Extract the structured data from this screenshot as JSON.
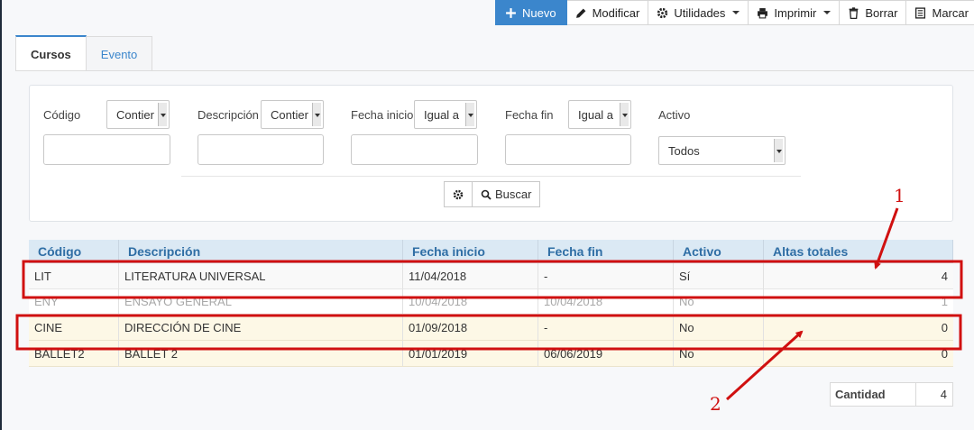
{
  "toolbar": {
    "nuevo": "Nuevo",
    "modificar": "Modificar",
    "utilidades": "Utilidades",
    "imprimir": "Imprimir",
    "borrar": "Borrar",
    "marcar": "Marcar"
  },
  "tabs": [
    {
      "label": "Cursos",
      "active": true
    },
    {
      "label": "Evento",
      "active": false
    }
  ],
  "filters": {
    "codigo": {
      "label": "Código",
      "operator": "Contier",
      "value": ""
    },
    "descripcion": {
      "label": "Descripción",
      "operator": "Contier",
      "value": ""
    },
    "fecha_inicio": {
      "label": "Fecha inicio",
      "operator": "Igual a",
      "value": ""
    },
    "fecha_fin": {
      "label": "Fecha fin",
      "operator": "Igual a",
      "value": ""
    },
    "activo": {
      "label": "Activo",
      "value": "Todos"
    },
    "buscar_label": "Buscar"
  },
  "table": {
    "headers": [
      "Código",
      "Descripción",
      "Fecha inicio",
      "Fecha fin",
      "Activo",
      "Altas totales"
    ],
    "rows": [
      [
        "LIT",
        "LITERATURA UNIVERSAL",
        "11/04/2018",
        "-",
        "Sí",
        "4"
      ],
      [
        "ENY",
        "ENSAYO GENERAL",
        "10/04/2018",
        "10/04/2018",
        "No",
        "1"
      ],
      [
        "CINE",
        "DIRECCIÓN DE CINE",
        "01/09/2018",
        "-",
        "No",
        "0"
      ],
      [
        "BALLET2",
        "BALLET 2",
        "01/01/2019",
        "06/06/2019",
        "No",
        "0"
      ]
    ]
  },
  "summary": {
    "label": "Cantidad",
    "value": "4"
  },
  "annotations": {
    "label_1": "1",
    "label_2": "2",
    "color": "#d01010"
  },
  "colors": {
    "primary": "#3b86cc",
    "header_bg": "#dbe9f4",
    "highlight_row": "#fdf8e6"
  }
}
